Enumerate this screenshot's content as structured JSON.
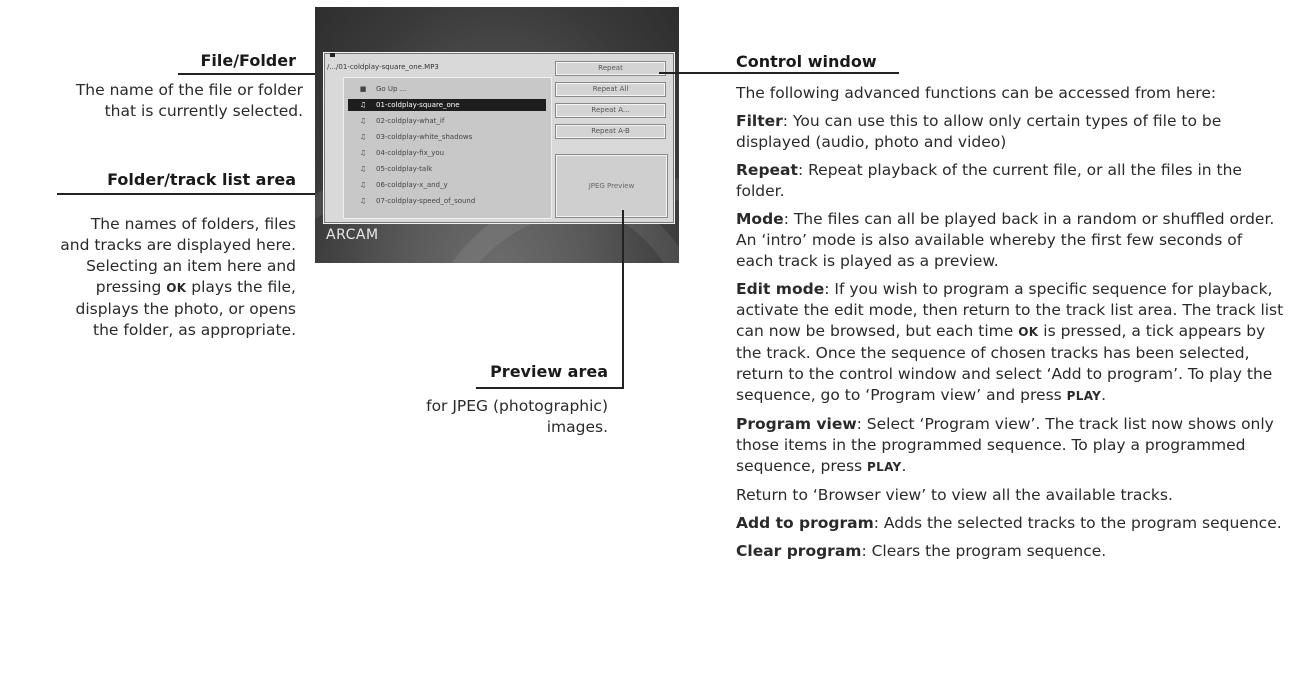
{
  "left": {
    "file_folder": {
      "heading": "File/Folder",
      "lines": [
        "The name of the file or folder",
        "that is currently selected."
      ]
    },
    "folder_track": {
      "heading": "Folder/track list area",
      "line1": "The names of folders, files",
      "line2": "and tracks are displayed here.",
      "line3": "Selecting an item here and",
      "line4_pre": "pressing ",
      "line4_kw": "OK",
      "line4_post": " plays the file,",
      "line5": "displays the photo, or opens",
      "line6": "the folder, as appropriate."
    }
  },
  "preview_area": {
    "heading": "Preview area",
    "line1": "for JPEG (photographic)",
    "line2": "images."
  },
  "screen": {
    "path": "/.../01-coldplay-square_one.MP3",
    "items": [
      {
        "icon": "folder-icon",
        "label": "Go Up ..."
      },
      {
        "icon": "music-note-icon",
        "label": "01-coldplay-square_one",
        "selected": true
      },
      {
        "icon": "music-note-icon",
        "label": "02-coldplay-what_if"
      },
      {
        "icon": "music-note-icon",
        "label": "03-coldplay-white_shadows"
      },
      {
        "icon": "music-note-icon",
        "label": "04-coldplay-fix_you"
      },
      {
        "icon": "music-note-icon",
        "label": "05-coldplay-talk"
      },
      {
        "icon": "music-note-icon",
        "label": "06-coldplay-x_and_y"
      },
      {
        "icon": "music-note-icon",
        "label": "07-coldplay-speed_of_sound"
      }
    ],
    "buttons": [
      "Repeat",
      "Repeat All",
      "Repeat A...",
      "Repeat A-B"
    ],
    "preview_label": "JPEG Preview",
    "logo": "ARCAM"
  },
  "right": {
    "heading": "Control window",
    "intro": "The following advanced functions can be accessed from here:",
    "filter_kw": "Filter",
    "filter_txt": ": You can use this to allow only certain types of file to be displayed (audio, photo and video)",
    "repeat_kw": "Repeat",
    "repeat_txt": ": Repeat playback of the current file, or all the files in the folder.",
    "mode_kw": "Mode",
    "mode_txt": ": The files can all be played back in a random or shuffled order. An ‘intro’ mode is also available whereby the first few seconds of each track is played as a preview.",
    "edit_kw": "Edit mode",
    "edit_txt1": ": If you wish to program a specific sequence for playback, activate the edit mode, then return to the track list area. The track list can now be browsed, but each time ",
    "edit_ok": "OK",
    "edit_txt2": " is pressed, a tick appears by the track. Once the sequence of chosen tracks has been selected, return to the control window and select ‘Add to program’. To play the sequence, go to ‘Program view’ and press ",
    "edit_play": "PLAY",
    "edit_end": ".",
    "pv_kw": "Program view",
    "pv_txt": ": Select ‘Program view’. The track list now shows only those items in the programmed sequence. To play a programmed sequence, press ",
    "pv_play": "PLAY",
    "pv_end": ".",
    "browser_txt": "Return to ‘Browser view’ to view all the available tracks.",
    "add_kw": "Add to program",
    "add_txt": ": Adds the selected tracks to the program sequence.",
    "clear_kw": "Clear program",
    "clear_txt": ": Clears the program sequence."
  }
}
